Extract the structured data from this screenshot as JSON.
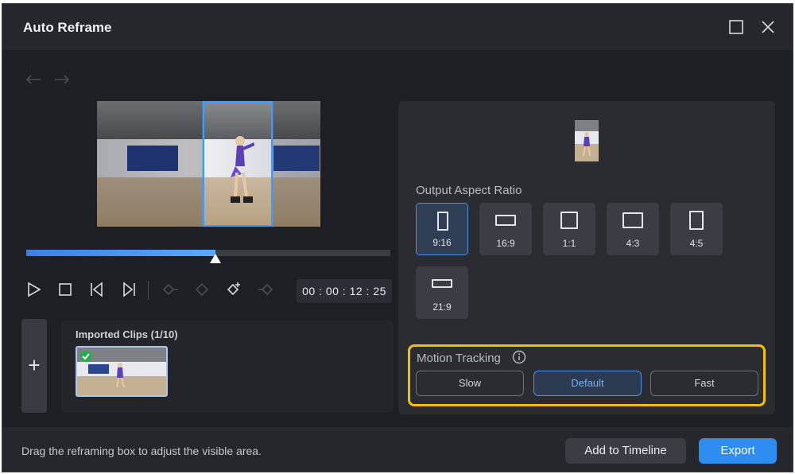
{
  "window": {
    "title": "Auto Reframe"
  },
  "playback": {
    "timecode": "00 : 00 : 12 : 25",
    "progress": 0.52
  },
  "clips": {
    "title": "Imported Clips (1/10)"
  },
  "output": {
    "label": "Output Aspect Ratio",
    "ratios": [
      {
        "label": "9:16",
        "selected": true
      },
      {
        "label": "16:9",
        "selected": false
      },
      {
        "label": "1:1",
        "selected": false
      },
      {
        "label": "4:3",
        "selected": false
      },
      {
        "label": "4:5",
        "selected": false
      },
      {
        "label": "21:9",
        "selected": false
      }
    ]
  },
  "motion_tracking": {
    "label": "Motion Tracking",
    "options": [
      "Slow",
      "Default",
      "Fast"
    ],
    "selected": "Default"
  },
  "footer": {
    "hint": "Drag the reframing box to adjust the visible area.",
    "add_to_timeline": "Add to Timeline",
    "export": "Export"
  },
  "colors": {
    "accent": "#2f8cf0",
    "highlight": "#f2c200",
    "selection": "#3f9bff"
  }
}
